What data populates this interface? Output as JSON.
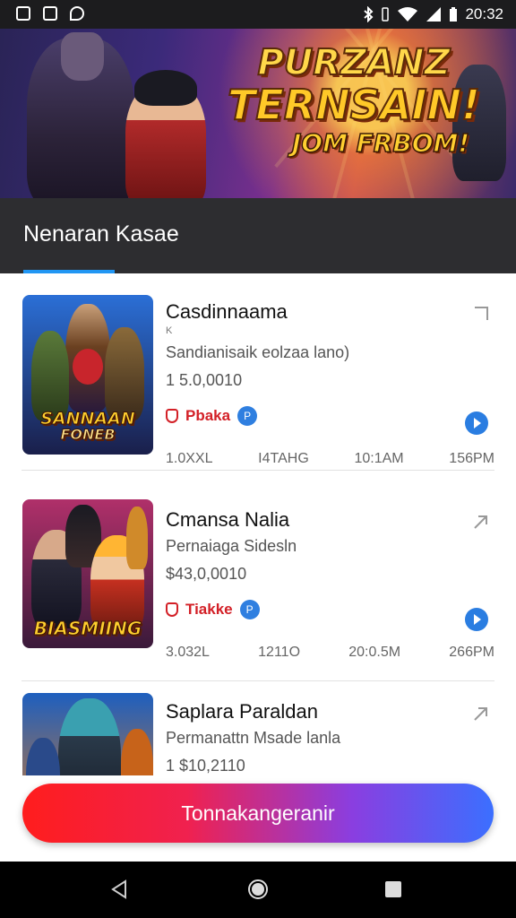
{
  "status_bar": {
    "time": "20:32",
    "left_icons": [
      "gallery-icon",
      "image-icon",
      "message-icon"
    ],
    "right_icons": [
      "bluetooth-icon",
      "vibrate-icon",
      "wifi-icon",
      "signal-icon",
      "battery-icon"
    ]
  },
  "banner": {
    "line1": "PURZANZ",
    "line2": "TERNSAIN!",
    "line3": "JOM FRBOM!"
  },
  "section": {
    "title": "Nenaran Kasae"
  },
  "cards": [
    {
      "title": "Casdinnaama",
      "tiny": "K",
      "subtitle": "Sandianisaik eolzaa lano)",
      "price": "1 5.0,0010",
      "tag": "Pbaka",
      "tag_icon": "P",
      "times": [
        "1.0XXL",
        "I4TAHG",
        "10:1AM",
        "156PM"
      ],
      "thumb_logo_1": "SANNAAN",
      "thumb_logo_2": "FONEB",
      "colors": {
        "bg_top": "#2b6fd6",
        "bg_bottom": "#1a1f4a"
      }
    },
    {
      "title": "Cmansa Nalia",
      "tiny": "",
      "subtitle": "Pernaiaga Sidesln",
      "price": "$43,0,0010",
      "tag": "Tiakke",
      "tag_icon": "P",
      "times": [
        "3.032L",
        "1211O",
        "20:0.5M",
        "266PM"
      ],
      "thumb_logo_1": "BIASMIING",
      "thumb_logo_2": "",
      "colors": {
        "bg_top": "#b0306a",
        "bg_bottom": "#3a1a3a"
      }
    },
    {
      "title": "Saplara Paraldan",
      "tiny": "",
      "subtitle": "Permanattn Msade lanla",
      "price": "1 $10,2110",
      "tag": "",
      "tag_icon": "",
      "times": [],
      "thumb_logo_1": "",
      "thumb_logo_2": "",
      "colors": {
        "bg_top": "#1e5fbf",
        "bg_bottom": "#e07a1a"
      }
    }
  ],
  "cta": {
    "label": "Tonnakangeranir"
  },
  "nav": {
    "back": "back-icon",
    "home": "home-icon",
    "recents": "recents-icon"
  }
}
